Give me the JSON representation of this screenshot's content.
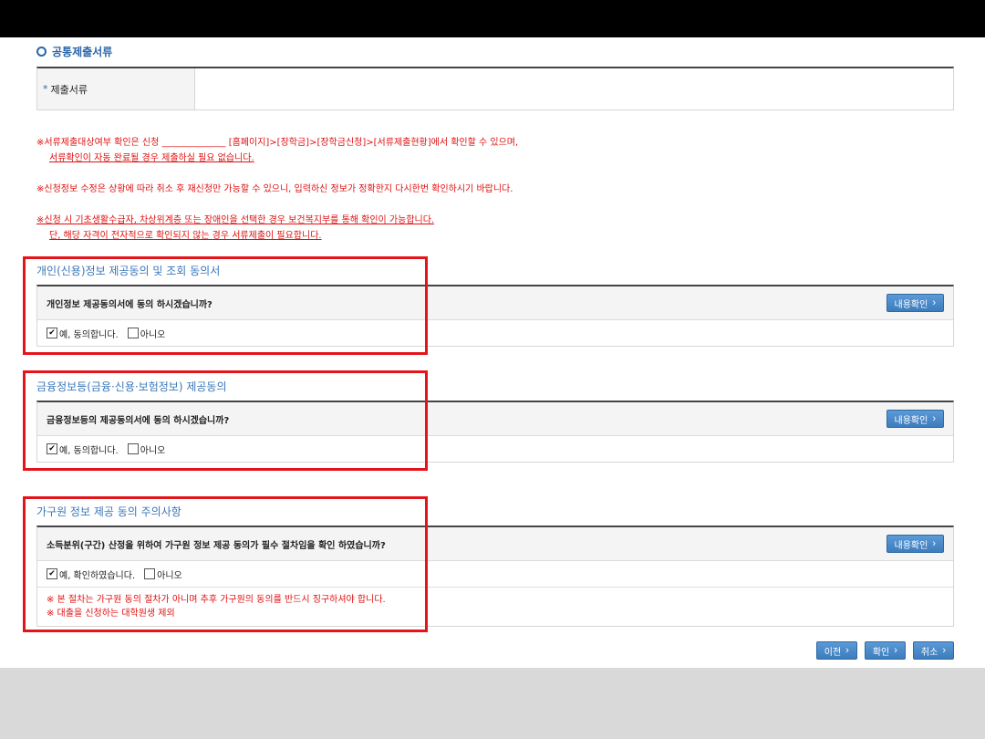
{
  "section": {
    "title": "공통제출서류"
  },
  "doc_table": {
    "header_required_mark": "*",
    "header_label": "제출서류",
    "value": ""
  },
  "notices": [
    {
      "lines": [
        "※서류제출대상여부 확인은 신청 ______________ [홈페이지]>[장학금]>[장학금신청]>[서류제출현황]에서 확인할 수 있으며,",
        "서류확인이 자동 완료될 경우 제출하실 필요 없습니다."
      ]
    },
    {
      "lines": [
        "※신청정보 수정은 상황에 따라 취소 후 재신청만 가능할 수 있으니, 입력하신 정보가 정확한지 다시한번 확인하시기 바랍니다."
      ]
    },
    {
      "lines": [
        "※신청 시 기초생활수급자, 차상위계층 또는 장애인을 선택한 경우 보건복지부를 통해 확인이 가능합니다.",
        "단, 해당 자격이 전자적으로 확인되지 않는 경우 서류제출이 필요합니다."
      ]
    }
  ],
  "consents": [
    {
      "title": "개인(신용)정보 제공동의 및 조회 동의서",
      "question": "개인정보 제공동의서에 동의 하시겠습니까?",
      "button": "내용확인",
      "agree_label": "예, 동의합니다.",
      "agree_checked": true,
      "decline_label": "아니오",
      "decline_checked": false
    },
    {
      "title": "금융정보등(금융·신용·보험정보) 제공동의",
      "question": "금융정보등의 제공동의서에 동의 하시겠습니까?",
      "button": "내용확인",
      "agree_label": "예, 동의합니다.",
      "agree_checked": true,
      "decline_label": "아니오",
      "decline_checked": false
    },
    {
      "title": "가구원 정보 제공 동의 주의사항",
      "question": "소득분위(구간) 산정을 위하여 가구원 정보 제공 동의가 필수 절차임을 확인 하였습니까?",
      "button": "내용확인",
      "agree_label": "예, 확인하였습니다.",
      "agree_checked": true,
      "decline_label": "아니오",
      "decline_checked": false,
      "warnings": [
        "※ 본 절차는 가구원 동의 절차가 아니며 추후 가구원의 동의를 반드시 징구하셔야 합니다.",
        "※ 대출을 신청하는 대학원생 제외"
      ]
    }
  ],
  "footer_buttons": {
    "prev": "이전",
    "confirm": "확인",
    "cancel": "취소"
  },
  "colors": {
    "highlight_frame": "#e5141b",
    "accent_blue": "#3d7dbd",
    "notice_red": "#e01010"
  }
}
